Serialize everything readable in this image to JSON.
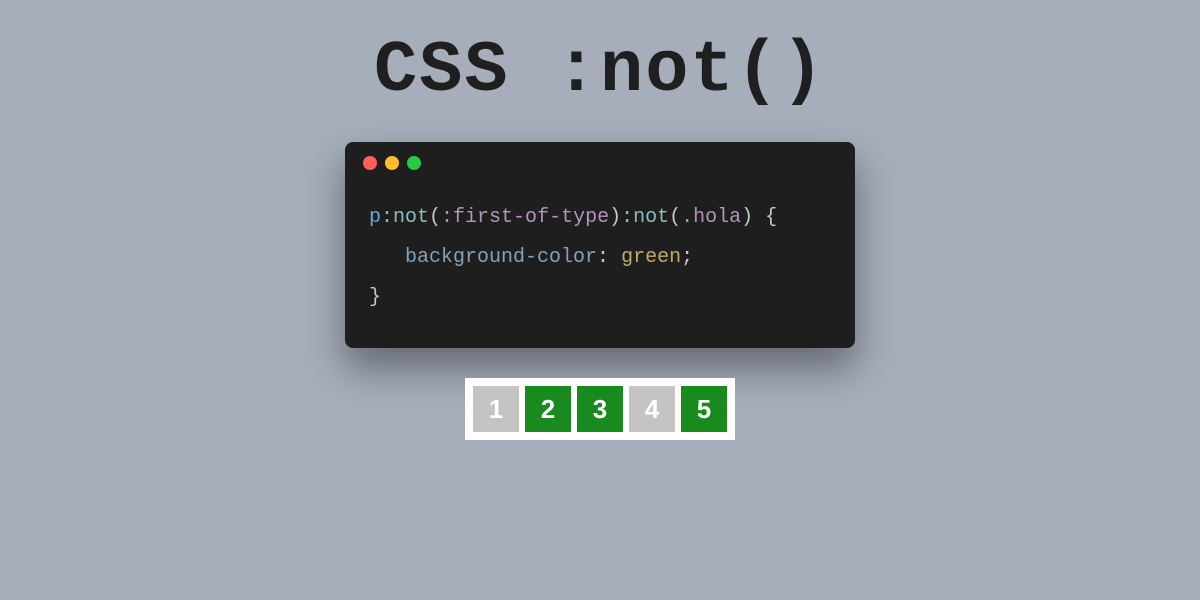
{
  "title": "CSS :not()",
  "code": {
    "line1": {
      "tag": "p",
      "pseudo1": ":not",
      "paren1a": "(",
      "arg1": ":first-of-type",
      "paren1b": ")",
      "pseudo2": ":not",
      "paren2a": "(",
      "arg2": ".hola",
      "paren2b": ")",
      "space": " ",
      "brace_open": "{"
    },
    "line2": {
      "indent": "   ",
      "prop": "background-color",
      "colon": ": ",
      "value": "green",
      "semi": ";"
    },
    "line3": {
      "brace_close": "}"
    }
  },
  "boxes": [
    {
      "label": "1",
      "variant": "grey"
    },
    {
      "label": "2",
      "variant": "green"
    },
    {
      "label": "3",
      "variant": "green"
    },
    {
      "label": "4",
      "variant": "grey"
    },
    {
      "label": "5",
      "variant": "green"
    }
  ],
  "colors": {
    "background": "#a6aebb",
    "code_bg": "#1e1e1e",
    "box_grey": "#c4c4c4",
    "box_green": "#188a1e"
  }
}
